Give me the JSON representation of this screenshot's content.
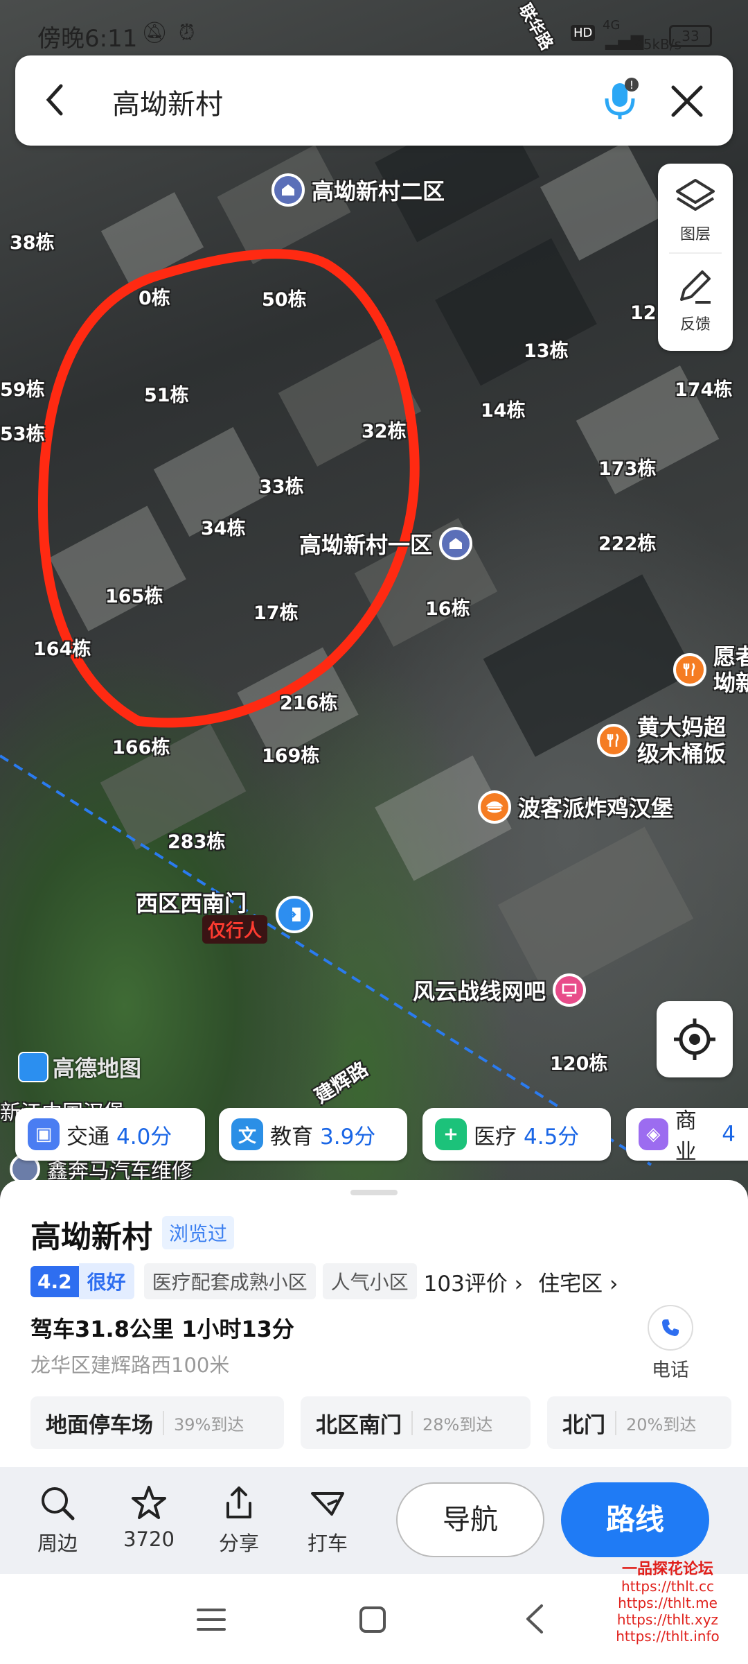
{
  "status_bar": {
    "time": "傍晚6:11",
    "network": "4G",
    "hd": "HD",
    "speed": "45kB/s",
    "battery": "33"
  },
  "search": {
    "back_label": "‹",
    "query": "高坳新村"
  },
  "map_controls": {
    "layers_label": "图层",
    "feedback_label": "反馈"
  },
  "map": {
    "labels": [
      "38栋",
      "50栋",
      "0栋",
      "51栋",
      "59栋",
      "53栋",
      "32栋",
      "33栋",
      "34栋",
      "165栋",
      "17栋",
      "16栋",
      "164栋",
      "216栋",
      "166栋",
      "169栋",
      "283栋",
      "13栋",
      "14栋",
      "12",
      "174栋",
      "173栋",
      "222栋",
      "120栋"
    ],
    "pois": {
      "zone2": "高坳新村二区",
      "zone1": "高坳新村一区",
      "gate": "西区西南门",
      "gate_note": "仅行人",
      "restaurant1": "愿者坳新",
      "restaurant2": "黄大妈超级木桶饭",
      "burger": "波客派炸鸡汉堡",
      "netcafe": "风云战线网吧",
      "road": "建辉路",
      "road2": "联华路",
      "bottom1": "新江中国汉堡",
      "bottom2": "鑫奔马汽车维修"
    },
    "watermark": "高德地图"
  },
  "scores": [
    {
      "name": "交通",
      "score": "4.0分",
      "color": "#4a7df2"
    },
    {
      "name": "教育",
      "score": "3.9分",
      "color": "#2b8fe6"
    },
    {
      "name": "医疗",
      "score": "4.5分",
      "color": "#1cc27a"
    },
    {
      "name": "商业",
      "score": "4",
      "color": "#9c6cf0"
    }
  ],
  "place": {
    "name": "高坳新村",
    "visited_badge": "浏览过",
    "rating": "4.2",
    "rating_text": "很好",
    "tags": [
      "医疗配套成熟小区",
      "人气小区"
    ],
    "reviews": "103评价",
    "category": "住宅区",
    "drive": "驾车31.8公里 1小时13分",
    "address": "龙华区建辉路西100米",
    "phone_label": "电话"
  },
  "entrances": [
    {
      "name": "地面停车场",
      "pct": "39%到达"
    },
    {
      "name": "北区南门",
      "pct": "28%到达"
    },
    {
      "name": "北门",
      "pct": "20%到达"
    }
  ],
  "actions": {
    "nearby": "周边",
    "favorite": "3720",
    "share": "分享",
    "taxi": "打车",
    "navigate": "导航",
    "route": "路线"
  },
  "overlay_watermark": [
    "一品探花论坛",
    "https://thlt.cc",
    "https://thlt.me",
    "https://thlt.xyz",
    "https://thlt.info"
  ]
}
